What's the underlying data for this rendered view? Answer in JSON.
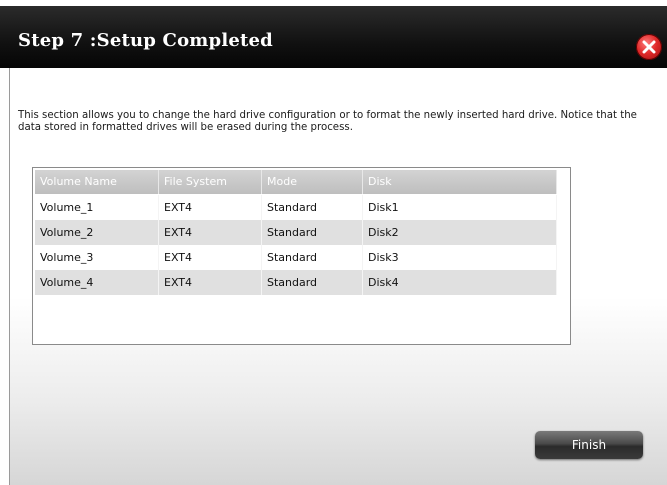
{
  "dialog": {
    "title": "Step 7 :Setup Completed",
    "close_icon": "close-icon"
  },
  "description": "This section allows you to change the hard drive configuration or to format the newly inserted hard drive. Notice that the data stored in formatted drives will be erased during the process.",
  "table": {
    "headers": [
      "Volume Name",
      "File System",
      "Mode",
      "Disk"
    ],
    "rows": [
      [
        "Volume_1",
        "EXT4",
        "Standard",
        "Disk1"
      ],
      [
        "Volume_2",
        "EXT4",
        "Standard",
        "Disk2"
      ],
      [
        "Volume_3",
        "EXT4",
        "Standard",
        "Disk3"
      ],
      [
        "Volume_4",
        "EXT4",
        "Standard",
        "Disk4"
      ]
    ]
  },
  "buttons": {
    "finish_label": "Finish"
  },
  "colors": {
    "title_bar": "#111111",
    "close_button": "#e02a2a",
    "header_row": "#bebebe",
    "alt_row": "#e0e0e0"
  }
}
